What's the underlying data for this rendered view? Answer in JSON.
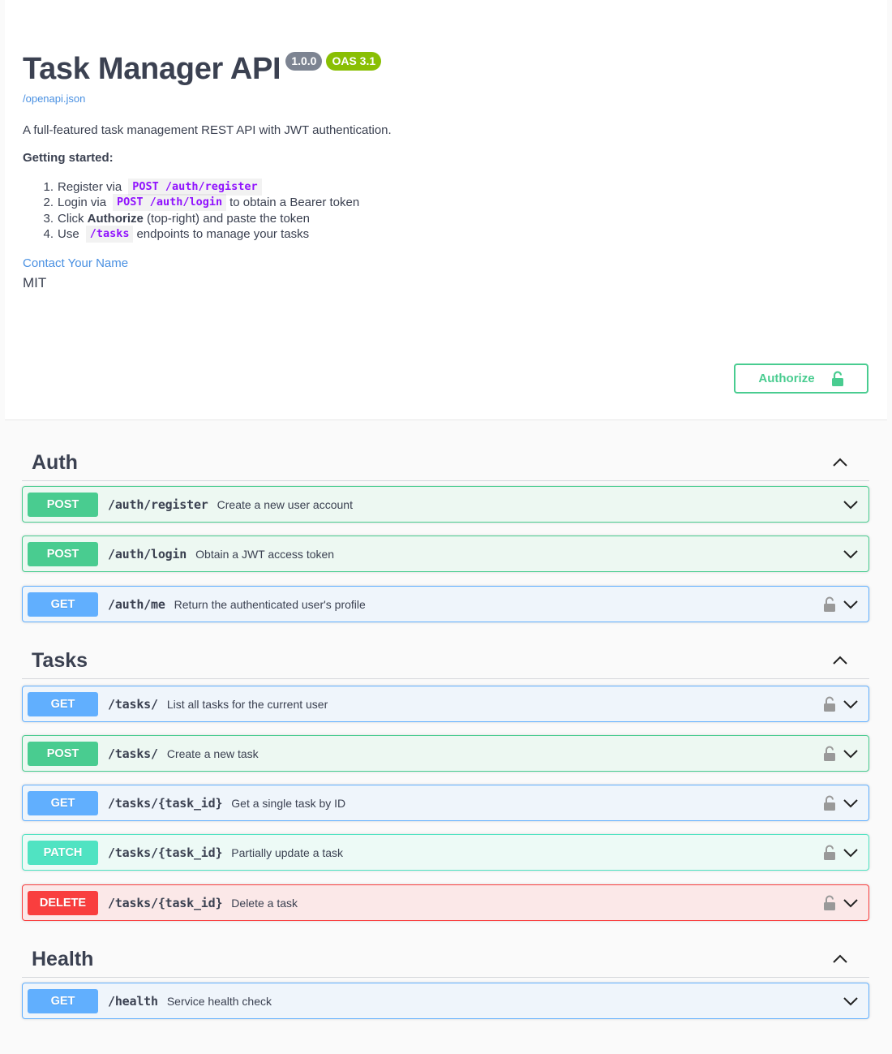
{
  "info": {
    "title": "Task Manager API",
    "version": "1.0.0",
    "oas": "OAS 3.1",
    "spec_link": "/openapi.json",
    "description": "A full-featured task management REST API with JWT authentication.",
    "getting_started": "Getting started:",
    "steps": [
      {
        "num": "1.",
        "pre": "Register via",
        "code": "POST /auth/register",
        "post": ""
      },
      {
        "num": "2.",
        "pre": "Login via",
        "code": "POST /auth/login",
        "post": "to obtain a Bearer token"
      },
      {
        "num": "3.",
        "pre": "Click",
        "bold": "Authorize",
        "post": "(top-right) and paste the token"
      },
      {
        "num": "4.",
        "pre": "Use",
        "code": "/tasks",
        "post": "endpoints to manage your tasks"
      }
    ],
    "contact": "Contact Your Name",
    "license": "MIT"
  },
  "authorize_label": "Authorize",
  "sections": [
    {
      "name": "Auth"
    },
    {
      "name": "Tasks"
    },
    {
      "name": "Health"
    }
  ],
  "ops": [
    {
      "method": "POST",
      "path": "/auth/register",
      "summary": "Create a new user account",
      "locked": false
    },
    {
      "method": "POST",
      "path": "/auth/login",
      "summary": "Obtain a JWT access token",
      "locked": false
    },
    {
      "method": "GET",
      "path": "/auth/me",
      "summary": "Return the authenticated user's profile",
      "locked": true
    },
    {
      "method": "GET",
      "path": "/tasks/",
      "summary": "List all tasks for the current user",
      "locked": true
    },
    {
      "method": "POST",
      "path": "/tasks/",
      "summary": "Create a new task",
      "locked": true
    },
    {
      "method": "GET",
      "path": "/tasks/{task_id}",
      "summary": "Get a single task by ID",
      "locked": true
    },
    {
      "method": "PATCH",
      "path": "/tasks/{task_id}",
      "summary": "Partially update a task",
      "locked": true
    },
    {
      "method": "DELETE",
      "path": "/tasks/{task_id}",
      "summary": "Delete a task",
      "locked": true
    },
    {
      "method": "GET",
      "path": "/health",
      "summary": "Service health check",
      "locked": false
    }
  ],
  "colors": {
    "post": "#49cc90",
    "get": "#61affe",
    "patch": "#50e3c2",
    "delete": "#f93e3e",
    "link": "#4990e2"
  },
  "icons": {
    "lock": "lock-icon",
    "unlock": "unlock-icon",
    "chevron_down": "chevron-down-icon",
    "chevron_up": "chevron-up-icon"
  }
}
